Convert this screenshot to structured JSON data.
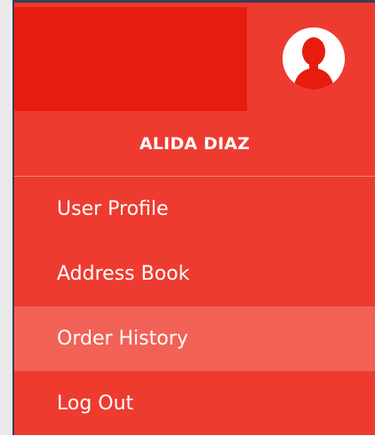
{
  "user": {
    "name": "ALIDA DIAZ",
    "avatar_icon": "user-avatar-icon"
  },
  "menu": {
    "items": [
      {
        "label": "User Profile",
        "active": false
      },
      {
        "label": "Address Book",
        "active": false
      },
      {
        "label": "Order History",
        "active": true
      },
      {
        "label": "Log Out",
        "active": false
      }
    ]
  },
  "colors": {
    "dropdown_bg": "#ee3b30",
    "header_block": "#e81b0f",
    "active_item": "#f16156",
    "text": "#ffffff"
  }
}
